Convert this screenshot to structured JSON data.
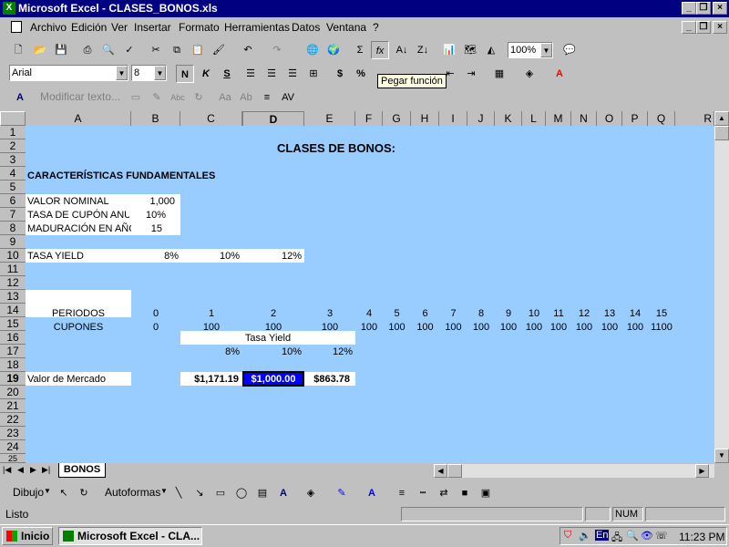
{
  "window": {
    "title": "Microsoft Excel - CLASES_BONOS.xls"
  },
  "menu": [
    "Archivo",
    "Edición",
    "Ver",
    "Insertar",
    "Formato",
    "Herramientas",
    "Datos",
    "Ventana",
    "?"
  ],
  "toolbar": {
    "zoom": "100%",
    "font": "Arial",
    "size": "8",
    "tooltip": "Pegar función",
    "edit_text": "Modificar texto..."
  },
  "columns": [
    "A",
    "B",
    "C",
    "D",
    "E",
    "F",
    "G",
    "H",
    "I",
    "J",
    "K",
    "L",
    "M",
    "N",
    "O",
    "P",
    "Q",
    "R"
  ],
  "rows": [
    "1",
    "2",
    "3",
    "4",
    "5",
    "6",
    "7",
    "8",
    "9",
    "10",
    "11",
    "12",
    "13",
    "14",
    "15",
    "16",
    "17",
    "18",
    "19",
    "20",
    "21",
    "22",
    "23",
    "24",
    "25"
  ],
  "sheet": {
    "title": "CLASES DE BONOS:",
    "section": "CARACTERÍSTICAS FUNDAMENTALES",
    "valor_nominal_label": "VALOR NOMINAL",
    "valor_nominal": "1,000",
    "tasa_cupon_label": "TASA DE CUPÓN ANUA",
    "tasa_cupon": "10%",
    "maduracion_label": "MADURACIÓN EN AÑOS",
    "maduracion": "15",
    "tasa_yield_label": "TASA YIELD",
    "yields": [
      "8%",
      "10%",
      "12%"
    ],
    "periodos_label": "PERIODOS",
    "periodos": [
      "0",
      "1",
      "2",
      "3",
      "4",
      "5",
      "6",
      "7",
      "8",
      "9",
      "10",
      "11",
      "12",
      "13",
      "14",
      "15"
    ],
    "cupones_label": "CUPONES",
    "cupones": [
      "0",
      "100",
      "100",
      "100",
      "100",
      "100",
      "100",
      "100",
      "100",
      "100",
      "100",
      "100",
      "100",
      "100",
      "100",
      "1100"
    ],
    "tasa_yield_header": "Tasa Yield",
    "yields2": [
      "8%",
      "10%",
      "12%"
    ],
    "valor_mercado_label": "Valor de Mercado",
    "valores": [
      "$1,171.19",
      "$1,000.00",
      "$863.78"
    ]
  },
  "sheet_tab": "BONOS",
  "drawbar": {
    "dibujo": "Dibujo",
    "autoformas": "Autoformas"
  },
  "status": {
    "text": "Listo",
    "num": "NUM"
  },
  "taskbar": {
    "start": "Inicio",
    "task": "Microsoft Excel - CLA...",
    "lang": "En",
    "time": "11:23 PM"
  },
  "colors": {
    "sheet_bg": "#99ccff",
    "title_bg": "#000080",
    "selected": "#0000ff"
  }
}
